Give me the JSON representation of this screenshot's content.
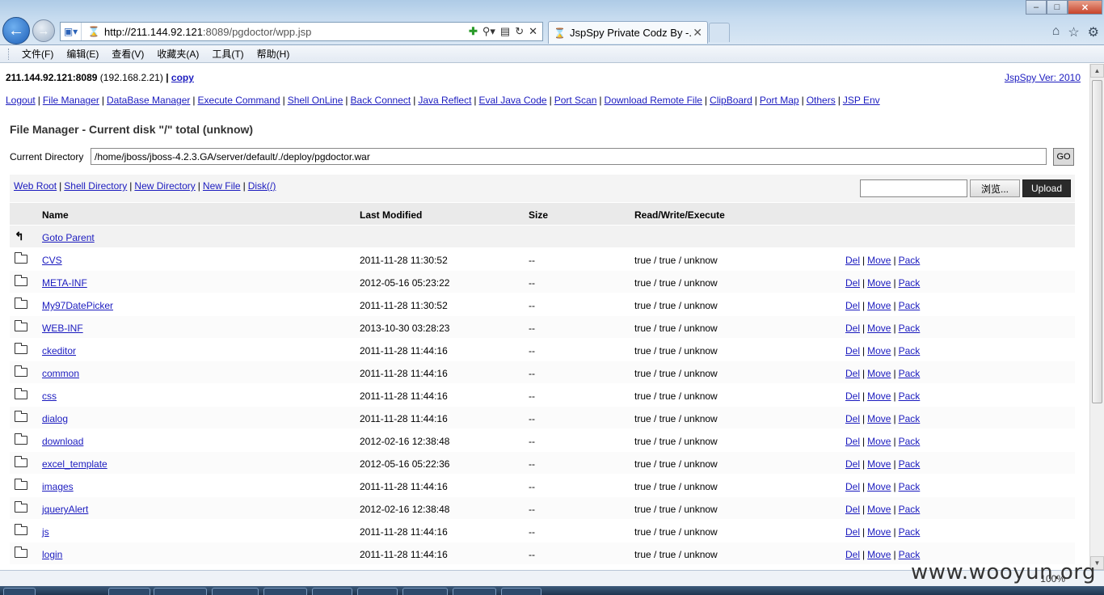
{
  "browser": {
    "url_host": "http://211.144.92.121",
    "url_rest": ":8089/pgdoctor/wpp.jsp",
    "tab_title": "JspSpy Private Codz By -...",
    "menu": [
      "文件(F)",
      "编辑(E)",
      "查看(V)",
      "收藏夹(A)",
      "工具(T)",
      "帮助(H)"
    ],
    "zoom": "100%"
  },
  "header": {
    "host": "211.144.92.121:8089",
    "local_ip": "(192.168.2.21)",
    "bar": "|",
    "copy_link": "copy",
    "version": "JspSpy Ver: 2010"
  },
  "nav_links": [
    "Logout",
    "File Manager",
    "DataBase Manager",
    "Execute Command",
    "Shell OnLine",
    "Back Connect",
    "Java Reflect",
    "Eval Java Code",
    "Port Scan",
    "Download Remote File",
    "ClipBoard",
    "Port Map",
    "Others",
    "JSP Env"
  ],
  "file_manager": {
    "title": "File Manager - Current disk \"/\" total (unknow)",
    "current_dir_label": "Current Directory",
    "current_dir_value": "/home/jboss/jboss-4.2.3.GA/server/default/./deploy/pgdoctor.war",
    "go_label": "GO",
    "quick_links": [
      "Web Root",
      "Shell Directory",
      "New Directory",
      "New File",
      "Disk(/)"
    ],
    "browse_label": "浏览...",
    "upload_label": "Upload"
  },
  "table": {
    "headers": {
      "name": "Name",
      "modified": "Last Modified",
      "size": "Size",
      "rwx": "Read/Write/Execute"
    },
    "parent_label": "Goto Parent",
    "action_labels": [
      "Del",
      "Move",
      "Pack"
    ],
    "rows": [
      {
        "name": "CVS",
        "modified": "2011-11-28 11:30:52",
        "size": "--",
        "rwx": "true / true / unknow"
      },
      {
        "name": "META-INF",
        "modified": "2012-05-16 05:23:22",
        "size": "--",
        "rwx": "true / true / unknow"
      },
      {
        "name": "My97DatePicker",
        "modified": "2011-11-28 11:30:52",
        "size": "--",
        "rwx": "true / true / unknow"
      },
      {
        "name": "WEB-INF",
        "modified": "2013-10-30 03:28:23",
        "size": "--",
        "rwx": "true / true / unknow"
      },
      {
        "name": "ckeditor",
        "modified": "2011-11-28 11:44:16",
        "size": "--",
        "rwx": "true / true / unknow"
      },
      {
        "name": "common",
        "modified": "2011-11-28 11:44:16",
        "size": "--",
        "rwx": "true / true / unknow"
      },
      {
        "name": "css",
        "modified": "2011-11-28 11:44:16",
        "size": "--",
        "rwx": "true / true / unknow"
      },
      {
        "name": "dialog",
        "modified": "2011-11-28 11:44:16",
        "size": "--",
        "rwx": "true / true / unknow"
      },
      {
        "name": "download",
        "modified": "2012-02-16 12:38:48",
        "size": "--",
        "rwx": "true / true / unknow"
      },
      {
        "name": "excel_template",
        "modified": "2012-05-16 05:22:36",
        "size": "--",
        "rwx": "true / true / unknow"
      },
      {
        "name": "images",
        "modified": "2011-11-28 11:44:16",
        "size": "--",
        "rwx": "true / true / unknow"
      },
      {
        "name": "jqueryAlert",
        "modified": "2012-02-16 12:38:48",
        "size": "--",
        "rwx": "true / true / unknow"
      },
      {
        "name": "js",
        "modified": "2011-11-28 11:44:16",
        "size": "--",
        "rwx": "true / true / unknow"
      },
      {
        "name": "login",
        "modified": "2011-11-28 11:44:16",
        "size": "--",
        "rwx": "true / true / unknow"
      }
    ]
  },
  "watermark": "www.wooyun.org",
  "colors": {
    "link": "#1b1bbf",
    "header_bg": "#eaeaea",
    "upload_btn": "#2a2a2a"
  }
}
